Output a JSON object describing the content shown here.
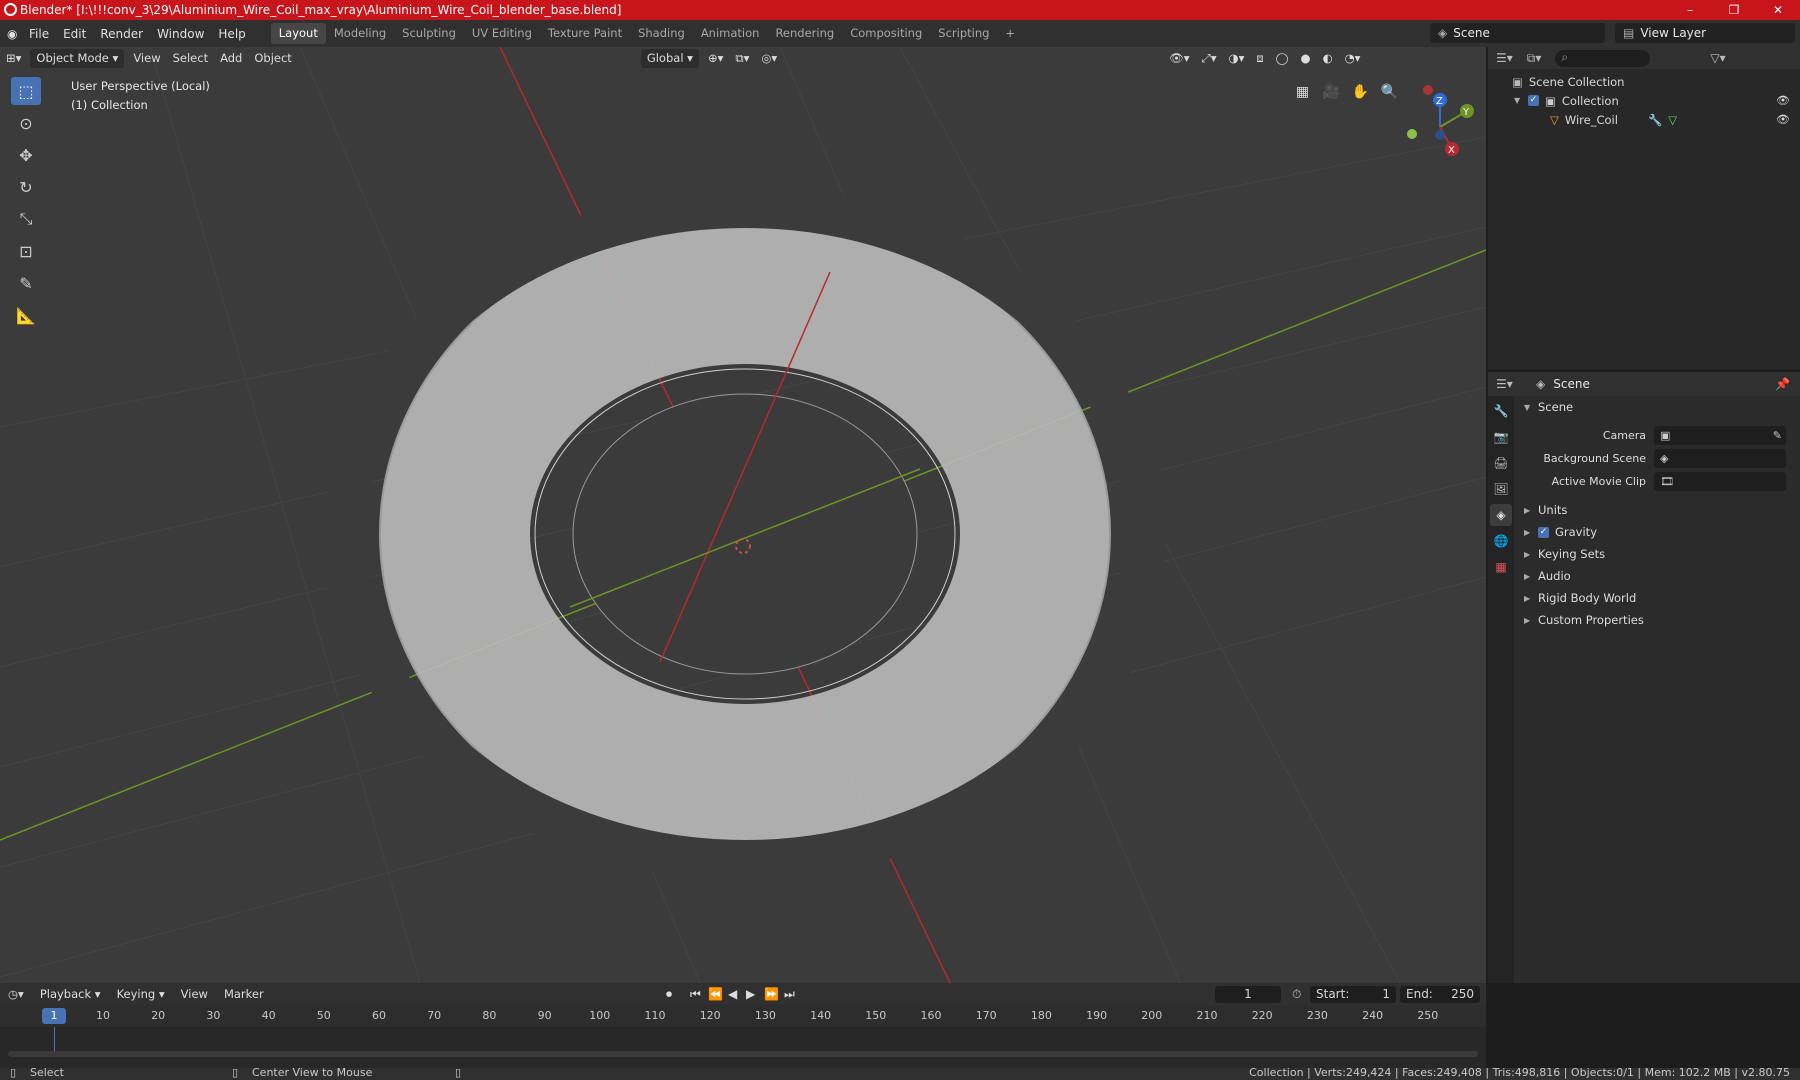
{
  "title_bar": {
    "title": "Blender* [I:\\!!!conv_3\\29\\Aluminium_Wire_Coil_max_vray\\Aluminium_Wire_Coil_blender_base.blend]",
    "controls": [
      "–",
      "❐",
      "✕"
    ]
  },
  "menu": {
    "items": [
      "File",
      "Edit",
      "Render",
      "Window",
      "Help"
    ],
    "workspaces": [
      "Layout",
      "Modeling",
      "Sculpting",
      "UV Editing",
      "Texture Paint",
      "Shading",
      "Animation",
      "Rendering",
      "Compositing",
      "Scripting"
    ],
    "active_workspace": "Layout",
    "add_workspace": "+",
    "scene": "Scene",
    "view_layer": "View Layer"
  },
  "viewport_header": {
    "mode": "Object Mode",
    "items": [
      "View",
      "Select",
      "Add",
      "Object"
    ],
    "orientation": "Global"
  },
  "viewport": {
    "perspective": "User Perspective (Local)",
    "collection": "(1) Collection",
    "object": "Wire_Coil"
  },
  "gizmo": {
    "z": "Z",
    "y": "Y",
    "x": "X"
  },
  "outliner": {
    "root": "Scene Collection",
    "collection": "Collection",
    "object": "Wire_Coil"
  },
  "properties": {
    "header": "Scene",
    "section": "Scene",
    "fields": [
      {
        "label": "Camera",
        "value": ""
      },
      {
        "label": "Background Scene",
        "value": ""
      },
      {
        "label": "Active Movie Clip",
        "value": ""
      }
    ],
    "subsections": [
      "Units",
      "Gravity",
      "Keying Sets",
      "Audio",
      "Rigid Body World",
      "Custom Properties"
    ],
    "gravity_enabled": true
  },
  "timeline": {
    "items": [
      "Playback",
      "Keying",
      "View",
      "Marker"
    ],
    "current_frame": "1",
    "start_label": "Start:",
    "start": "1",
    "end_label": "End:",
    "end": "250",
    "ticks": [
      "10",
      "20",
      "30",
      "40",
      "50",
      "60",
      "70",
      "80",
      "90",
      "100",
      "110",
      "120",
      "130",
      "140",
      "150",
      "160",
      "170",
      "180",
      "190",
      "200",
      "210",
      "220",
      "230",
      "240",
      "250"
    ]
  },
  "status": {
    "left": "Select",
    "middle": "Center View to Mouse",
    "right": "Collection | Verts:249,424 | Faces:249,408 | Tris:498,816 | Objects:0/1 | Mem: 102.2 MB | v2.80.75"
  },
  "colors": {
    "title_bar": "#c8141b",
    "accent": "#4772b3",
    "x_axis": "#b52a30",
    "y_axis": "#6e9424"
  }
}
